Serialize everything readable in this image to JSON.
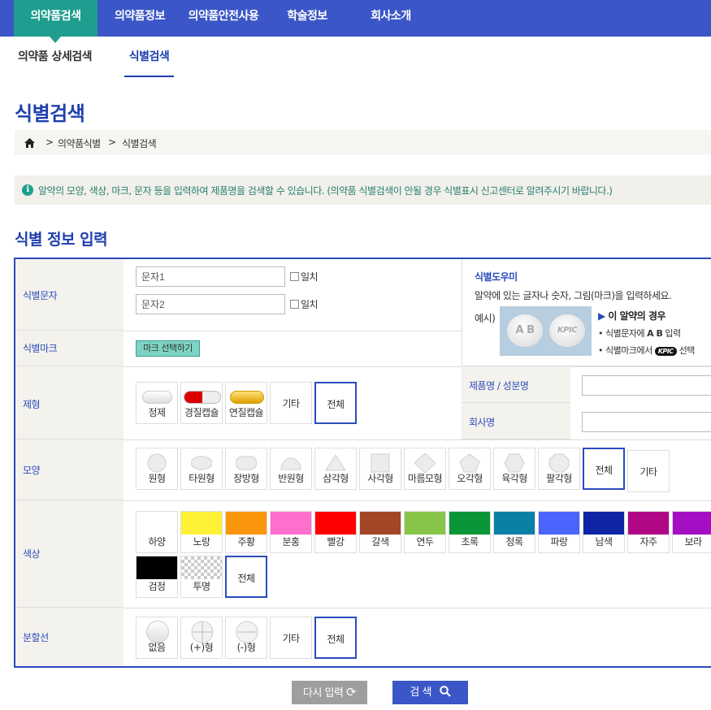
{
  "nav": [
    "의약품검색",
    "의약품정보",
    "의약품안전사용",
    "학술정보",
    "회사소개"
  ],
  "subnav": [
    "의약품 상세검색",
    "식별검색"
  ],
  "page_title": "식별검색",
  "breadcrumb": [
    "의약품식별",
    "식별검색"
  ],
  "notice": "알약의 모양, 색상, 마크, 문자 등을 입력하여 제품명을 검색할 수 있습니다. (의약품 식별검색이 안될 경우 식별표시 신고센터로 알려주시기 바랍니다.)",
  "section_title": "식별 정보 입력",
  "labels": {
    "text": "식별문자",
    "mark": "식별마크",
    "form": "제형",
    "shape": "모양",
    "color": "색상",
    "line": "분할선",
    "product": "제품명 / 성분명",
    "company": "회사명"
  },
  "fields": {
    "text1": "문자1",
    "text2": "문자2",
    "match": "일치",
    "mark_btn": "마크 선택하기"
  },
  "helper": {
    "title": "식별도우미",
    "desc": "알약에 있는 글자나 숫자, 그림(마크)을 입력하세요.",
    "example": "예시)",
    "case": "이 알약의 경우",
    "step1_pre": "식별문자에",
    "step1_bold": "A B",
    "step1_post": "입력",
    "step2_pre": "식별마크에서",
    "step2_mark": "KPIC",
    "step2_post": "선택",
    "pill1": "A B",
    "pill2": "KPIC"
  },
  "forms": [
    "정제",
    "경질캡슐",
    "연질캡슐",
    "기타",
    "전체"
  ],
  "shapes": [
    "원형",
    "타원형",
    "장방형",
    "반원형",
    "삼각형",
    "사각형",
    "마름모형",
    "오각형",
    "육각형",
    "팔각형",
    "전체",
    "기타"
  ],
  "colors": [
    {
      "name": "하양",
      "hex": "#ffffff"
    },
    {
      "name": "노랑",
      "hex": "#fff236"
    },
    {
      "name": "주황",
      "hex": "#f9960c"
    },
    {
      "name": "분홍",
      "hex": "#ff6fce"
    },
    {
      "name": "빨강",
      "hex": "#fe0000"
    },
    {
      "name": "갈색",
      "hex": "#a14725"
    },
    {
      "name": "연두",
      "hex": "#86c547"
    },
    {
      "name": "초록",
      "hex": "#0a9637"
    },
    {
      "name": "청록",
      "hex": "#0a81a4"
    },
    {
      "name": "파랑",
      "hex": "#4a64fc"
    },
    {
      "name": "남색",
      "hex": "#0d24a4"
    },
    {
      "name": "자주",
      "hex": "#b10686"
    },
    {
      "name": "보라",
      "hex": "#a40fc4"
    },
    {
      "name": "검정",
      "hex": "#000000"
    },
    {
      "name": "투명",
      "hex": "transparent"
    },
    {
      "name": "전체",
      "hex": ""
    }
  ],
  "lines": [
    "없음",
    "(+)형",
    "(-)형",
    "기타",
    "전체"
  ],
  "buttons": {
    "reset": "다시 입력",
    "search": "검 색"
  }
}
